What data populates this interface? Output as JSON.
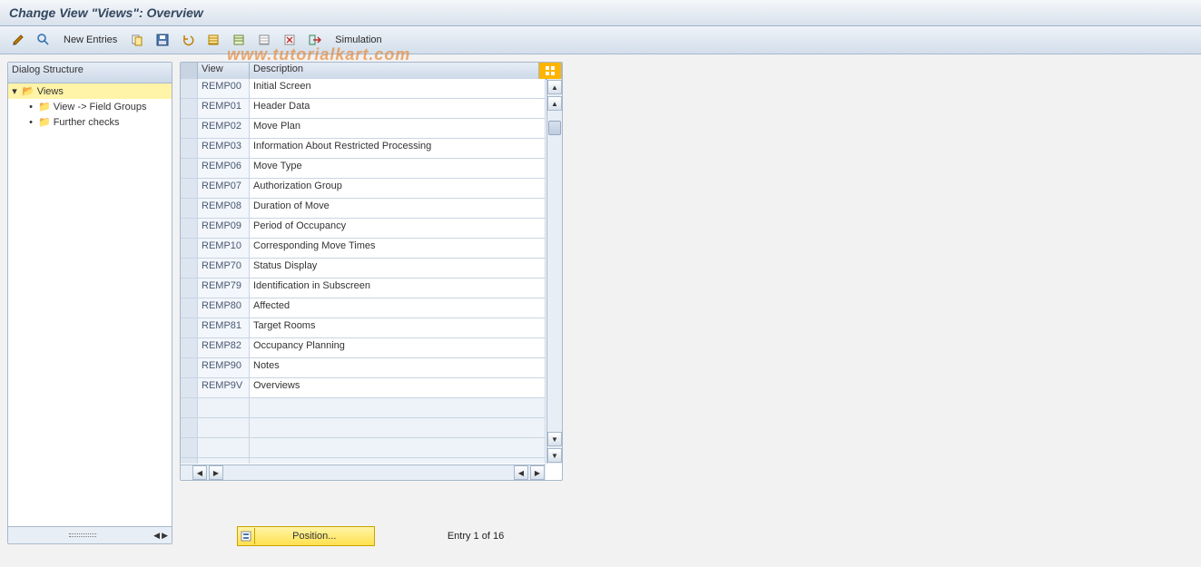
{
  "title": "Change View \"Views\": Overview",
  "watermark": "www.tutorialkart.com",
  "toolbar": {
    "new_entries": "New Entries",
    "simulation": "Simulation"
  },
  "tree": {
    "header": "Dialog Structure",
    "root": "Views",
    "child1": "View -> Field Groups",
    "child2": "Further checks"
  },
  "grid": {
    "col_view": "View",
    "col_desc": "Description",
    "rows": [
      {
        "view": "REMP00",
        "desc": "Initial Screen"
      },
      {
        "view": "REMP01",
        "desc": "Header Data"
      },
      {
        "view": "REMP02",
        "desc": "Move Plan"
      },
      {
        "view": "REMP03",
        "desc": "Information About Restricted Processing"
      },
      {
        "view": "REMP06",
        "desc": "Move Type"
      },
      {
        "view": "REMP07",
        "desc": "Authorization Group"
      },
      {
        "view": "REMP08",
        "desc": "Duration of Move"
      },
      {
        "view": "REMP09",
        "desc": "Period of Occupancy"
      },
      {
        "view": "REMP10",
        "desc": "Corresponding Move Times"
      },
      {
        "view": "REMP70",
        "desc": "Status Display"
      },
      {
        "view": "REMP79",
        "desc": "Identification in Subscreen"
      },
      {
        "view": "REMP80",
        "desc": "Affected"
      },
      {
        "view": "REMP81",
        "desc": "Target Rooms"
      },
      {
        "view": "REMP82",
        "desc": "Occupancy Planning"
      },
      {
        "view": "REMP90",
        "desc": "Notes"
      },
      {
        "view": "REMP9V",
        "desc": "Overviews"
      }
    ]
  },
  "footer": {
    "position": "Position...",
    "entry": "Entry 1 of 16"
  }
}
